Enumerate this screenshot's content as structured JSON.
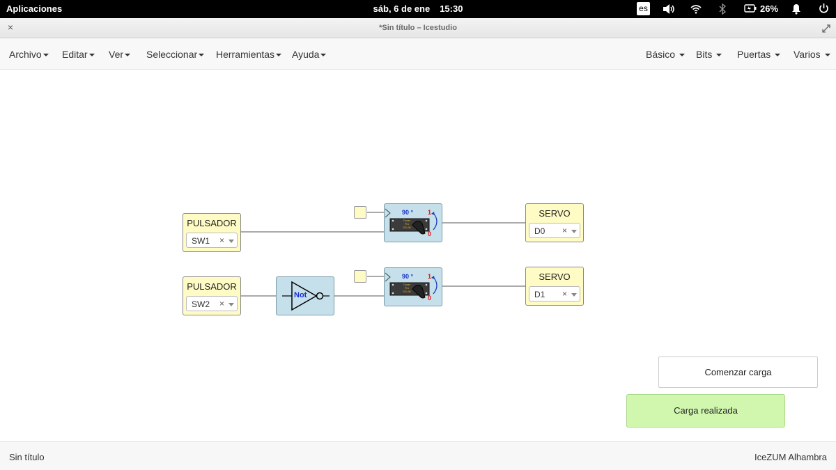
{
  "system_bar": {
    "apps_label": "Aplicaciones",
    "date": "sáb,  6 de ene",
    "time": "15:30",
    "lang": "es",
    "battery": "26%",
    "icons": [
      "volume-icon",
      "wifi-icon",
      "bluetooth-icon",
      "battery-icon",
      "bell-icon",
      "power-icon"
    ]
  },
  "window": {
    "title": "*Sin título – Icestudio"
  },
  "menu": {
    "left": [
      "Archivo",
      "Editar",
      "Ver",
      "Seleccionar",
      "Herramientas",
      "Ayuda"
    ],
    "right": [
      "Básico",
      "Bits",
      "Puertas",
      "Varios"
    ]
  },
  "circuit": {
    "inputs": [
      {
        "label": "PULSADOR",
        "pin": "SW1"
      },
      {
        "label": "PULSADOR",
        "pin": "SW2"
      }
    ],
    "outputs": [
      {
        "label": "SERVO",
        "pin": "D0"
      },
      {
        "label": "SERVO",
        "pin": "D1"
      }
    ],
    "gate": {
      "label": "Not"
    },
    "servo_block": {
      "angle": "90 °",
      "high": "1",
      "low": "0",
      "lines": [
        "Tower",
        "Pro",
        "SG-90"
      ]
    },
    "pin_clear": "×"
  },
  "buttons": {
    "start": "Comenzar carga",
    "done": "Carga realizada"
  },
  "status": {
    "left": "Sin título",
    "right": "IceZUM Alhambra"
  },
  "colors": {
    "io_block": "#fffbc5",
    "logic_block": "#c5e0ea",
    "success": "#d0f7ad"
  }
}
